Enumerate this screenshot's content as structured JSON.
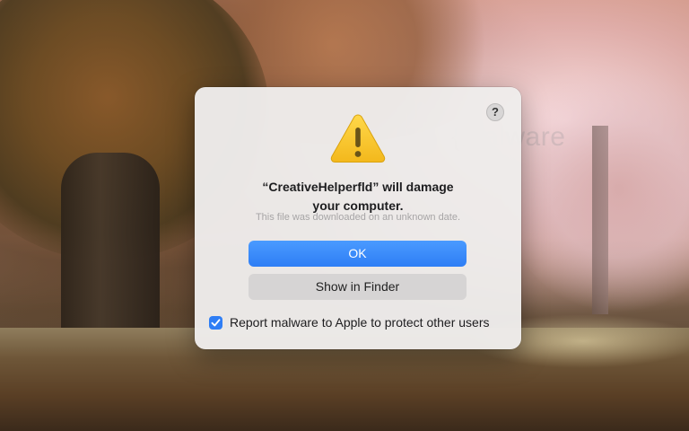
{
  "watermark": {
    "text": "{malware"
  },
  "dialog": {
    "help_label": "?",
    "icon": "warning-triangle-icon",
    "title": "“CreativeHelperfld” will damage\nyour computer.",
    "subtitle": "This file was downloaded on an unknown date.",
    "ok_label": "OK",
    "finder_label": "Show in Finder",
    "report_checked": true,
    "report_label": "Report malware to Apple to protect other users"
  },
  "colors": {
    "accent": "#2e7ef5",
    "warning_yellow": "#f7c52b",
    "dialog_bg": "#eeeceb"
  }
}
